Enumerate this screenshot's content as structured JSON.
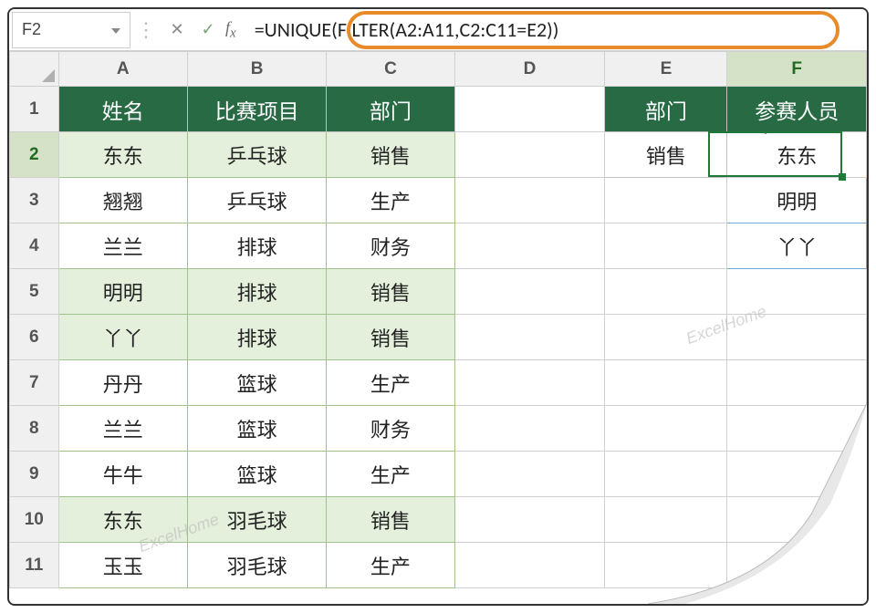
{
  "namebox": {
    "value": "F2"
  },
  "formula": "=UNIQUE(FILTER(A2:A11,C2:C11=E2))",
  "columns": [
    "A",
    "B",
    "C",
    "D",
    "E",
    "F"
  ],
  "rows": [
    "1",
    "2",
    "3",
    "4",
    "5",
    "6",
    "7",
    "8",
    "9",
    "10",
    "11"
  ],
  "active_col": "F",
  "active_row": "2",
  "headers_main": {
    "A": "姓名",
    "B": "比赛项目",
    "C": "部门"
  },
  "headers_side": {
    "E": "部门",
    "F": "参赛人员"
  },
  "table": [
    {
      "name": "东东",
      "event": "乒乓球",
      "dept": "销售",
      "hl": true
    },
    {
      "name": "翘翘",
      "event": "乒乓球",
      "dept": "生产",
      "hl": false
    },
    {
      "name": "兰兰",
      "event": "排球",
      "dept": "财务",
      "hl": false
    },
    {
      "name": "明明",
      "event": "排球",
      "dept": "销售",
      "hl": true
    },
    {
      "name": "丫丫",
      "event": "排球",
      "dept": "销售",
      "hl": true
    },
    {
      "name": "丹丹",
      "event": "篮球",
      "dept": "生产",
      "hl": false
    },
    {
      "name": "兰兰",
      "event": "篮球",
      "dept": "财务",
      "hl": false
    },
    {
      "name": "牛牛",
      "event": "篮球",
      "dept": "生产",
      "hl": false
    },
    {
      "name": "东东",
      "event": "羽毛球",
      "dept": "销售",
      "hl": true
    },
    {
      "name": "玉玉",
      "event": "羽毛球",
      "dept": "生产",
      "hl": false
    }
  ],
  "criteria_dept": "销售",
  "results": [
    "东东",
    "明明",
    "丫丫"
  ],
  "watermark": "ExcelHome"
}
